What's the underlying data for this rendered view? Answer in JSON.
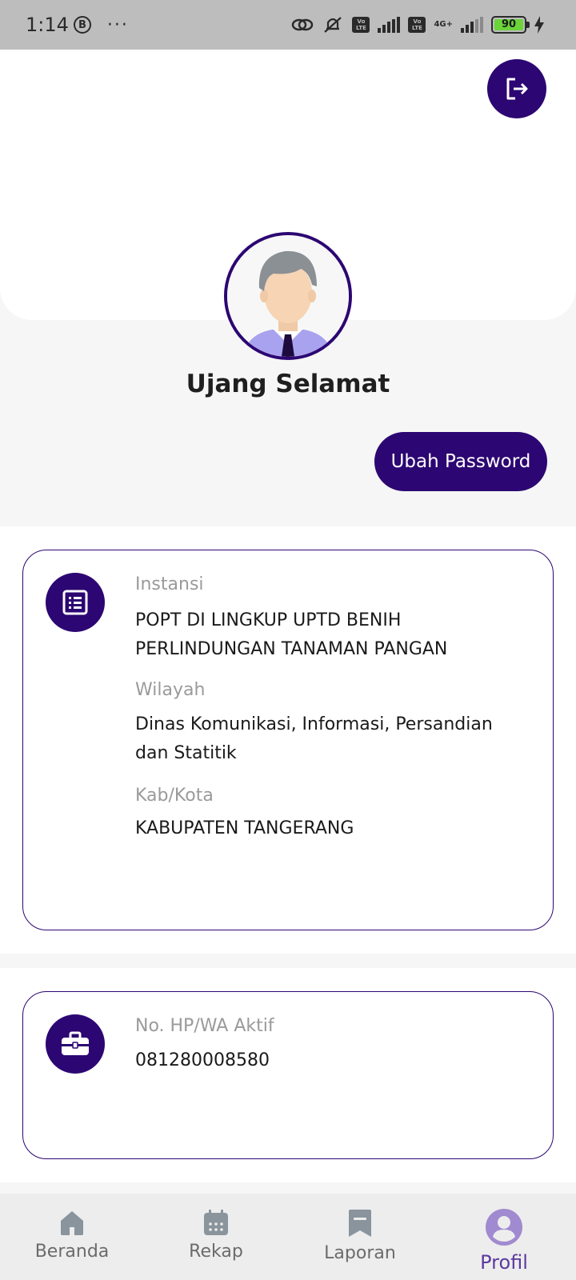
{
  "status_bar": {
    "time": "1:14",
    "b_badge": "B",
    "more": "···",
    "volte1": "Vo LTE",
    "volte2": "Vo LTE",
    "network": "4G+",
    "battery": "90"
  },
  "profile": {
    "name": "Ujang Selamat",
    "change_password_label": "Ubah Password"
  },
  "org_card": {
    "instansi_label": "Instansi",
    "instansi_value": "POPT DI LINGKUP UPTD BENIH PERLINDUNGAN TANAMAN PANGAN",
    "wilayah_label": "Wilayah",
    "wilayah_value": "Dinas Komunikasi, Informasi, Persandian dan Statitik",
    "kabkota_label": "Kab/Kota",
    "kabkota_value": "KABUPATEN TANGERANG"
  },
  "contact_card": {
    "phone_label": "No. HP/WA Aktif",
    "phone_value": "081280008580"
  },
  "nav": {
    "items": [
      {
        "label": "Beranda",
        "icon": "home-icon"
      },
      {
        "label": "Rekap",
        "icon": "calendar-icon"
      },
      {
        "label": "Laporan",
        "icon": "bookmark-icon"
      },
      {
        "label": "Profil",
        "icon": "user-icon"
      }
    ],
    "active": "Profil"
  },
  "colors": {
    "primary": "#2c0672",
    "nav_active": "#5b3a9e"
  }
}
